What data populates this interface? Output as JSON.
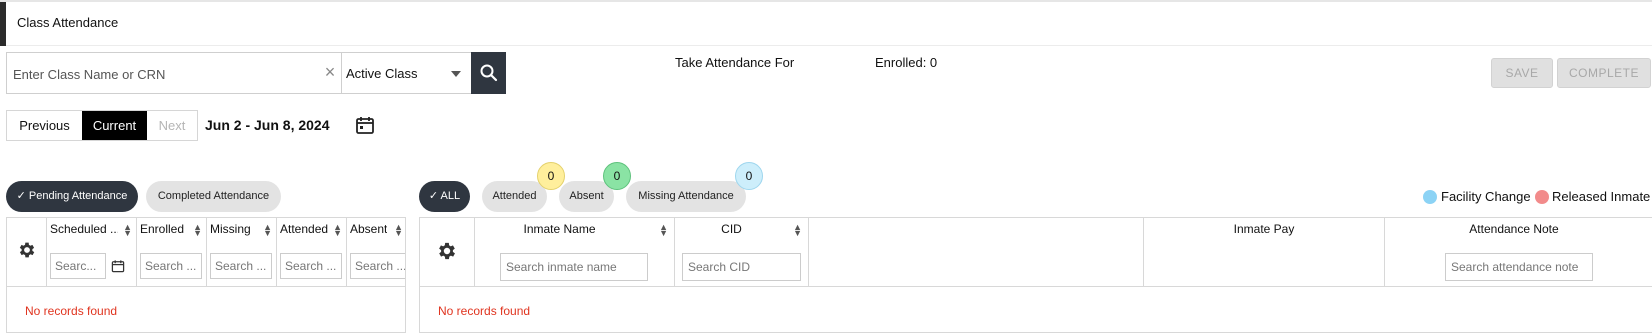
{
  "header": {
    "title": "Class Attendance"
  },
  "class_search": {
    "placeholder": "Enter Class Name or CRN",
    "value": ""
  },
  "status_select": {
    "selected": "Active Class"
  },
  "take_attendance": {
    "label": "Take Attendance For",
    "enrolled": "Enrolled: 0"
  },
  "actions": {
    "save": "SAVE",
    "complete": "COMPLETE"
  },
  "week_nav": {
    "previous": "Previous",
    "current": "Current",
    "next": "Next",
    "range": "Jun 2 - Jun 8, 2024"
  },
  "left_panel": {
    "tabs": [
      {
        "label": "✓ Pending Attendance",
        "active": true
      },
      {
        "label": "Completed Attendance",
        "active": false
      }
    ],
    "columns": [
      {
        "header": "Scheduled ...",
        "placeholder": "Searc..."
      },
      {
        "header": "Enrolled",
        "placeholder": "Search ..."
      },
      {
        "header": "Missing",
        "placeholder": "Search ..."
      },
      {
        "header": "Attended",
        "placeholder": "Search ..."
      },
      {
        "header": "Absent",
        "placeholder": "Search ..."
      }
    ],
    "empty_message": "No records found"
  },
  "right_panel": {
    "filters": [
      {
        "label": "✓ ALL",
        "active": true
      },
      {
        "label": "Attended",
        "count": "0"
      },
      {
        "label": "Absent",
        "count": "0"
      },
      {
        "label": "Missing Attendance",
        "count": "0"
      }
    ],
    "legend": [
      {
        "label": "Facility Change",
        "color": "#8cd3f5"
      },
      {
        "label": "Released Inmate",
        "color": "#f28b8b"
      }
    ],
    "columns": [
      {
        "header": "Inmate Name",
        "placeholder": "Search inmate name"
      },
      {
        "header": "CID",
        "placeholder": "Search CID"
      },
      {
        "header": ""
      },
      {
        "header": "Inmate Pay"
      },
      {
        "header": "Attendance Note",
        "placeholder": "Search attendance note"
      }
    ],
    "empty_message": "No records found"
  },
  "colors": {
    "dark": "#2f3640",
    "error": "#e0341f",
    "badge_attended": "#ffef9c",
    "badge_absent": "#8ae3a4",
    "badge_missing": "#cdeefb"
  }
}
